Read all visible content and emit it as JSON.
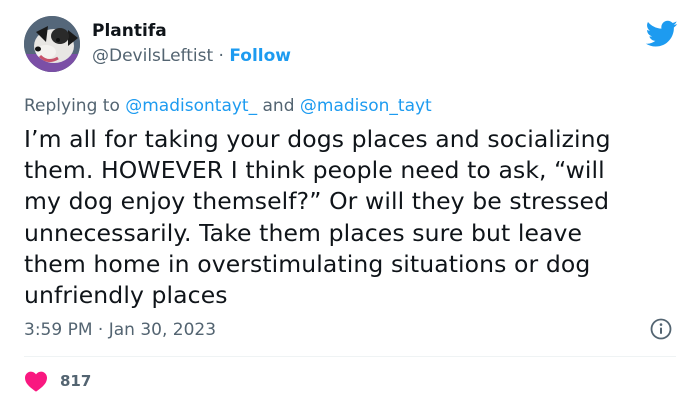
{
  "author": {
    "display_name": "Plantifa",
    "handle": "@DevilsLeftist",
    "separator": " · ",
    "follow_label": "Follow"
  },
  "reply": {
    "prefix": "Replying to ",
    "mention_1": "@madisontayt_",
    "conjunction": " and ",
    "mention_2": "@madison_tayt"
  },
  "tweet": {
    "text": "I’m all for taking your dogs places and socializing\nthem. HOWEVER I think people need to ask, “will\nmy dog enjoy themself?” Or will they be stressed\nunnecessarily. Take them places sure but leave\nthem home in overstimulating situations or dog\nunfriendly places",
    "timestamp": "3:59 PM · Jan 30, 2023"
  },
  "engagement": {
    "like_count": "817"
  },
  "icons": {
    "brand": "twitter-bird-icon",
    "info": "info-icon",
    "like": "heart-icon"
  },
  "colors": {
    "accent": "#1d9bf0",
    "text": "#0f1419",
    "muted": "#536471",
    "heart": "#f91880"
  }
}
